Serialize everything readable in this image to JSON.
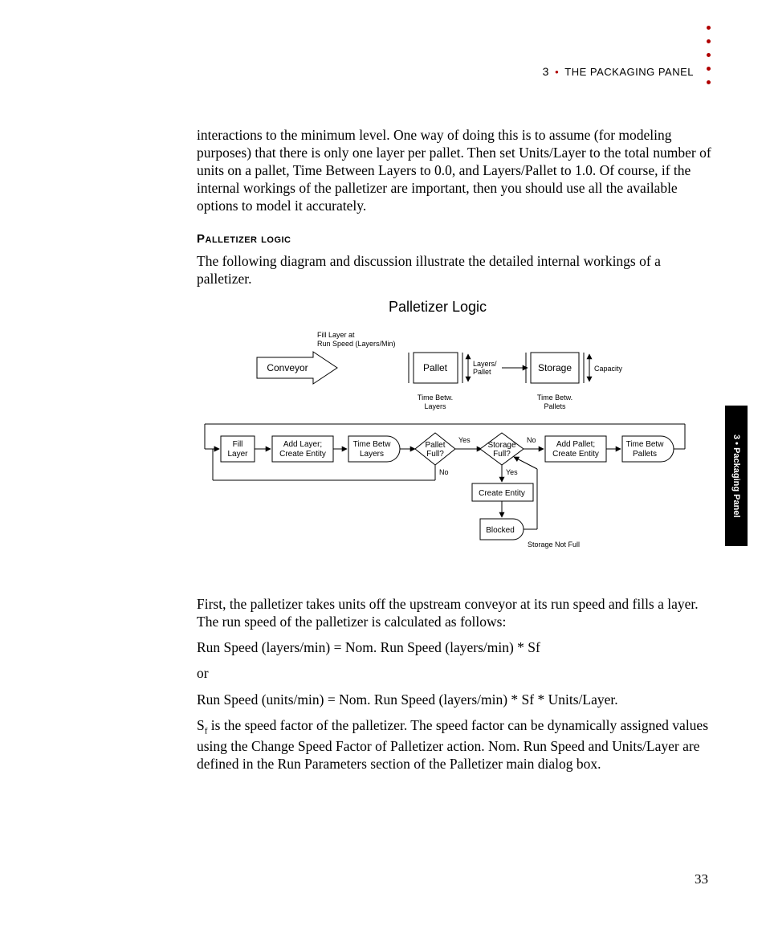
{
  "header": {
    "num": "3",
    "bullet": "•",
    "title": "THE PACKAGING PANEL"
  },
  "tab": "3 • Packaging Panel",
  "pageNum": "33",
  "p1": "interactions to the minimum level. One way of doing this is to assume (for modeling purposes) that there is only one layer per pallet. Then set Units/Layer to the total number of units on a pallet, Time Between Layers to 0.0, and Layers/Pallet to 1.0. Of course, if the internal workings of the palletizer are important, then you should use all the available options to model it accurately.",
  "h1": "Palletizer logic",
  "p2": "The following diagram and discussion illustrate the detailed internal workings of a palletizer.",
  "fig": {
    "title": "Palletizer Logic",
    "topCaption1": "Fill Layer at",
    "topCaption2": "Run Speed (Layers/Min)",
    "conveyor": "Conveyor",
    "pallet": "Pallet",
    "storage": "Storage",
    "layersPallet1": "Layers/",
    "layersPallet2": "Pallet",
    "capacity": "Capacity",
    "tbl1": "Time Betw.",
    "tbl2": "Layers",
    "tbp1": "Time Betw.",
    "tbp2": "Pallets",
    "fillLayer1": "Fill",
    "fillLayer2": "Layer",
    "addLayer1": "Add Layer;",
    "addLayer2": "Create Entity",
    "timeBetw": "Time Betw",
    "timeBetwLayers": "Layers",
    "palletFull1": "Pallet",
    "palletFull2": "Full?",
    "storageFull1": "Storage",
    "storageFull2": "Full?",
    "addPallet1": "Add Pallet;",
    "addPallet2": "Create Entity",
    "timeBetwPallets": "Pallets",
    "createEntity": "Create Entity",
    "blocked": "Blocked",
    "storageNotFull": "Storage Not Full",
    "yes": "Yes",
    "no": "No"
  },
  "p3": "First, the palletizer takes units off the upstream conveyor at its run speed and fills a layer. The run speed of the palletizer is calculated as follows:",
  "eq1": "Run Speed (layers/min) = Nom. Run Speed (layers/min) * Sf",
  "or_": "or",
  "eq2": "Run Speed (units/min) = Nom. Run Speed (layers/min) * Sf * Units/Layer.",
  "p4a": "S",
  "p4sub": "f",
  "p4b": " is the speed factor of the palletizer. The speed factor can be dynamically assigned values using the Change Speed Factor of Palletizer action. Nom. Run Speed and Units/Layer are defined in the Run Parameters section of the Palletizer main dialog box."
}
